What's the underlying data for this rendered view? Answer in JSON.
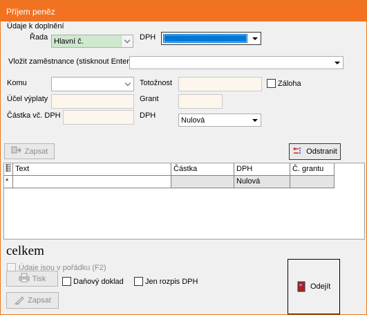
{
  "window": {
    "title": "Příjem peněz"
  },
  "group": {
    "label": "Údaje k doplnění"
  },
  "rada": {
    "label": "Řada",
    "value": "Hlavní č."
  },
  "dph_top": {
    "label": "DPH",
    "value": ""
  },
  "employee": {
    "label": "Vložit zaměstnance (stisknout Enter)",
    "value": ""
  },
  "komu": {
    "label": "Komu",
    "value": ""
  },
  "totoznost": {
    "label": "Totožnost",
    "value": ""
  },
  "zaloha": {
    "label": "Záloha"
  },
  "ucel": {
    "label": "Účel výplaty",
    "value": ""
  },
  "grant": {
    "label": "Grant",
    "value": ""
  },
  "castka": {
    "label": "Částka vč. DPH",
    "value": ""
  },
  "dph_bottom": {
    "label": "DPH",
    "value": "Nulová"
  },
  "buttons": {
    "zapsat_top": "Zapsat",
    "odstranit": "Odstranit",
    "tisk": "Tisk",
    "zapsat_bottom": "Zapsat",
    "odejit": "Odejít"
  },
  "table": {
    "columns": [
      "Text",
      "Částka",
      "DPH",
      "Č. grantu"
    ],
    "new_row_marker": "*",
    "new_row": {
      "text": "",
      "castka": "",
      "dph": "Nulová",
      "grant": ""
    }
  },
  "summary": {
    "celkem": "celkem"
  },
  "checks": {
    "udaje": "Údaje jsou v pořádku (F2)",
    "danovy": "Daňový doklad",
    "rozpis": "Jen rozpis DPH"
  },
  "colors": {
    "titlebar": "#f27221",
    "selected_combo": "#0078d7",
    "input_bg": "#fdf6ec"
  }
}
